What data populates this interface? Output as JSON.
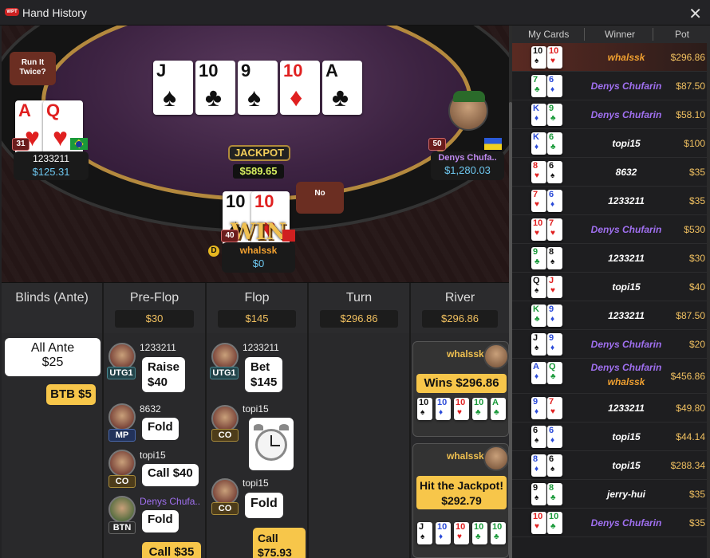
{
  "window": {
    "title": "Hand History",
    "logo_text": "WPT"
  },
  "table": {
    "community_cards": [
      {
        "rank": "J",
        "suit": "♠",
        "color": "blk"
      },
      {
        "rank": "10",
        "suit": "♣",
        "color": "blk"
      },
      {
        "rank": "9",
        "suit": "♠",
        "color": "blk"
      },
      {
        "rank": "10",
        "suit": "♦",
        "color": "red"
      },
      {
        "rank": "A",
        "suit": "♣",
        "color": "blk"
      }
    ],
    "run_it_twice": "Run It Twice?",
    "no_bubble": "No",
    "jackpot_label": "JACKPOT",
    "jackpot_amount": "$589.65",
    "win_overlay": "WIN",
    "dealer_button": "D",
    "players": {
      "left": {
        "name": "1233211",
        "stack": "$125.31",
        "level": "31",
        "cards": [
          {
            "rank": "A",
            "suit": "♥"
          },
          {
            "rank": "Q",
            "suit": "♥"
          }
        ]
      },
      "right": {
        "name": "Denys Chufa..",
        "stack": "$1,280.03",
        "level": "50"
      },
      "bottom": {
        "name": "whalssk",
        "stack": "$0",
        "level": "40",
        "cards": [
          {
            "rank": "10",
            "suit": "♠"
          },
          {
            "rank": "10",
            "suit": "♥"
          }
        ]
      }
    }
  },
  "streets": {
    "headers": [
      {
        "name": "Blinds (Ante)",
        "pot": ""
      },
      {
        "name": "Pre-Flop",
        "pot": "$30"
      },
      {
        "name": "Flop",
        "pot": "$145"
      },
      {
        "name": "Turn",
        "pot": "$296.86"
      },
      {
        "name": "River",
        "pot": "$296.86"
      }
    ],
    "blinds": {
      "all_ante": "All Ante",
      "ante_amount": "$25",
      "btb": "BTB",
      "btb_amount": "$5"
    },
    "preflop": [
      {
        "player": "1233211",
        "position": "UTG1",
        "action": "Raise",
        "amount": "$40"
      },
      {
        "player": "8632",
        "position": "MP",
        "action": "Fold",
        "amount": ""
      },
      {
        "player": "topi15",
        "position": "CO",
        "action": "Call",
        "amount": "$40"
      },
      {
        "player": "Denys Chufa..",
        "position": "BTN",
        "action": "Fold",
        "amount": ""
      }
    ],
    "preflop_last": "Call  $35",
    "flop": [
      {
        "player": "1233211",
        "position": "UTG1",
        "action": "Bet",
        "amount": "$145"
      },
      {
        "player": "topi15",
        "position": "CO",
        "action": "",
        "amount": ""
      },
      {
        "player": "topi15",
        "position": "CO",
        "action": "Fold",
        "amount": ""
      }
    ],
    "flop_last": "Call",
    "flop_last_amount": "$75.93",
    "river": [
      {
        "player": "whalssk",
        "result": "Wins $296.86"
      },
      {
        "player": "whalssk",
        "result": "Hit the Jackpot!",
        "amount": "$292.79"
      }
    ]
  },
  "history": {
    "headers": {
      "cards": "My Cards",
      "winner": "Winner",
      "pot": "Pot"
    },
    "rows": [
      {
        "cards": [
          [
            "10",
            "♠",
            "blk"
          ],
          [
            "10",
            "♥",
            "red"
          ]
        ],
        "winners": [
          "whalssk"
        ],
        "wcolor": [
          "#f0a030"
        ],
        "pot": "$296.86",
        "selected": true
      },
      {
        "cards": [
          [
            "7",
            "♣",
            "grn"
          ],
          [
            "6",
            "♦",
            "blu"
          ]
        ],
        "winners": [
          "Denys Chufarin"
        ],
        "wcolor": [
          "#a070f0"
        ],
        "pot": "$87.50"
      },
      {
        "cards": [
          [
            "K",
            "♦",
            "blu"
          ],
          [
            "9",
            "♣",
            "grn"
          ]
        ],
        "winners": [
          "Denys Chufarin"
        ],
        "wcolor": [
          "#a070f0"
        ],
        "pot": "$58.10"
      },
      {
        "cards": [
          [
            "K",
            "♦",
            "blu"
          ],
          [
            "6",
            "♣",
            "grn"
          ]
        ],
        "winners": [
          "topi15"
        ],
        "wcolor": [
          "#ffffff"
        ],
        "pot": "$100"
      },
      {
        "cards": [
          [
            "8",
            "♥",
            "red"
          ],
          [
            "6",
            "♠",
            "blk"
          ]
        ],
        "winners": [
          "8632"
        ],
        "wcolor": [
          "#ffffff"
        ],
        "pot": "$35"
      },
      {
        "cards": [
          [
            "7",
            "♥",
            "red"
          ],
          [
            "6",
            "♦",
            "blu"
          ]
        ],
        "winners": [
          "1233211"
        ],
        "wcolor": [
          "#ffffff"
        ],
        "pot": "$35"
      },
      {
        "cards": [
          [
            "10",
            "♥",
            "red"
          ],
          [
            "7",
            "♥",
            "red"
          ]
        ],
        "winners": [
          "Denys Chufarin"
        ],
        "wcolor": [
          "#a070f0"
        ],
        "pot": "$530"
      },
      {
        "cards": [
          [
            "9",
            "♣",
            "grn"
          ],
          [
            "8",
            "♠",
            "blk"
          ]
        ],
        "winners": [
          "1233211"
        ],
        "wcolor": [
          "#ffffff"
        ],
        "pot": "$30"
      },
      {
        "cards": [
          [
            "Q",
            "♠",
            "blk"
          ],
          [
            "J",
            "♥",
            "red"
          ]
        ],
        "winners": [
          "topi15"
        ],
        "wcolor": [
          "#ffffff"
        ],
        "pot": "$40"
      },
      {
        "cards": [
          [
            "K",
            "♣",
            "grn"
          ],
          [
            "9",
            "♦",
            "blu"
          ]
        ],
        "winners": [
          "1233211"
        ],
        "wcolor": [
          "#ffffff"
        ],
        "pot": "$87.50"
      },
      {
        "cards": [
          [
            "J",
            "♠",
            "blk"
          ],
          [
            "9",
            "♦",
            "blu"
          ]
        ],
        "winners": [
          "Denys Chufarin"
        ],
        "wcolor": [
          "#a070f0"
        ],
        "pot": "$20"
      },
      {
        "cards": [
          [
            "A",
            "♦",
            "blu"
          ],
          [
            "Q",
            "♣",
            "grn"
          ]
        ],
        "winners": [
          "Denys Chufarin",
          "whalssk"
        ],
        "wcolor": [
          "#a070f0",
          "#f0a030"
        ],
        "pot": "$456.86"
      },
      {
        "cards": [
          [
            "9",
            "♦",
            "blu"
          ],
          [
            "7",
            "♥",
            "red"
          ]
        ],
        "winners": [
          "1233211"
        ],
        "wcolor": [
          "#ffffff"
        ],
        "pot": "$49.80"
      },
      {
        "cards": [
          [
            "6",
            "♠",
            "blk"
          ],
          [
            "6",
            "♦",
            "blu"
          ]
        ],
        "winners": [
          "topi15"
        ],
        "wcolor": [
          "#ffffff"
        ],
        "pot": "$44.14"
      },
      {
        "cards": [
          [
            "8",
            "♦",
            "blu"
          ],
          [
            "6",
            "♠",
            "blk"
          ]
        ],
        "winners": [
          "topi15"
        ],
        "wcolor": [
          "#ffffff"
        ],
        "pot": "$288.34"
      },
      {
        "cards": [
          [
            "9",
            "♠",
            "blk"
          ],
          [
            "8",
            "♣",
            "grn"
          ]
        ],
        "winners": [
          "jerry-hui"
        ],
        "wcolor": [
          "#ffffff"
        ],
        "pot": "$35"
      },
      {
        "cards": [
          [
            "10",
            "♥",
            "red"
          ],
          [
            "10",
            "♣",
            "grn"
          ]
        ],
        "winners": [
          "Denys Chufarin"
        ],
        "wcolor": [
          "#a070f0"
        ],
        "pot": "$35"
      }
    ]
  },
  "colors": {
    "accent_gold": "#f0c060",
    "win_yellow": "#f7c64a",
    "felt": "#3d2342"
  }
}
